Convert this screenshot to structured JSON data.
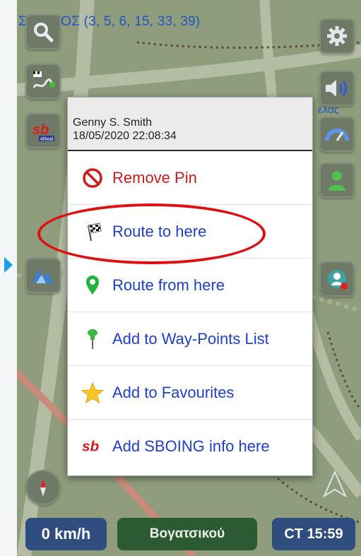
{
  "map": {
    "street_label": "ΣΤΥΡΓΟΣ (3, 5, 6, 15, 33, 39)",
    "side_text": "ελας"
  },
  "popup": {
    "author": "Genny S. Smith",
    "timestamp": "18/05/2020 22:08:34",
    "items": [
      {
        "label": "Remove Pin",
        "icon": "no-entry-icon",
        "color": "#d11b1b"
      },
      {
        "label": "Route to here",
        "icon": "checkered-flag-icon",
        "color": "#1d3fd0"
      },
      {
        "label": "Route from here",
        "icon": "map-pin-icon",
        "color": "#1d3fd0"
      },
      {
        "label": "Add to Way-Points List",
        "icon": "push-pin-icon",
        "color": "#1d3fd0"
      },
      {
        "label": "Add to Favourites",
        "icon": "star-icon",
        "color": "#1d3fd0"
      },
      {
        "label": "Add SBOING info here",
        "icon": "sboing-logo-icon",
        "color": "#1d3fd0"
      }
    ],
    "highlighted_item": "Route to here"
  },
  "status_bar": {
    "speed": "0 km/h",
    "street": "Βογατσικού",
    "time": "CT 15:59"
  },
  "buttons": {
    "search": "search-icon",
    "settings": "gear-icon",
    "route": "route-icon",
    "volume": "speaker-icon",
    "sboing": "sboing-4real-icon",
    "speedometer": "speedometer-icon",
    "user": "user-icon",
    "poi": "poi-icon",
    "meeting": "meeting-icon",
    "compass": "compass-icon",
    "navigate": "navigate-arrow-icon"
  },
  "colors": {
    "accent_blue": "#1d3fd0",
    "danger_red": "#d11b1b",
    "speed_box": "#2f4d7e",
    "street_box": "#2c5a32",
    "map_bg": "#8f9d7d",
    "ellipse": "#e01010"
  }
}
